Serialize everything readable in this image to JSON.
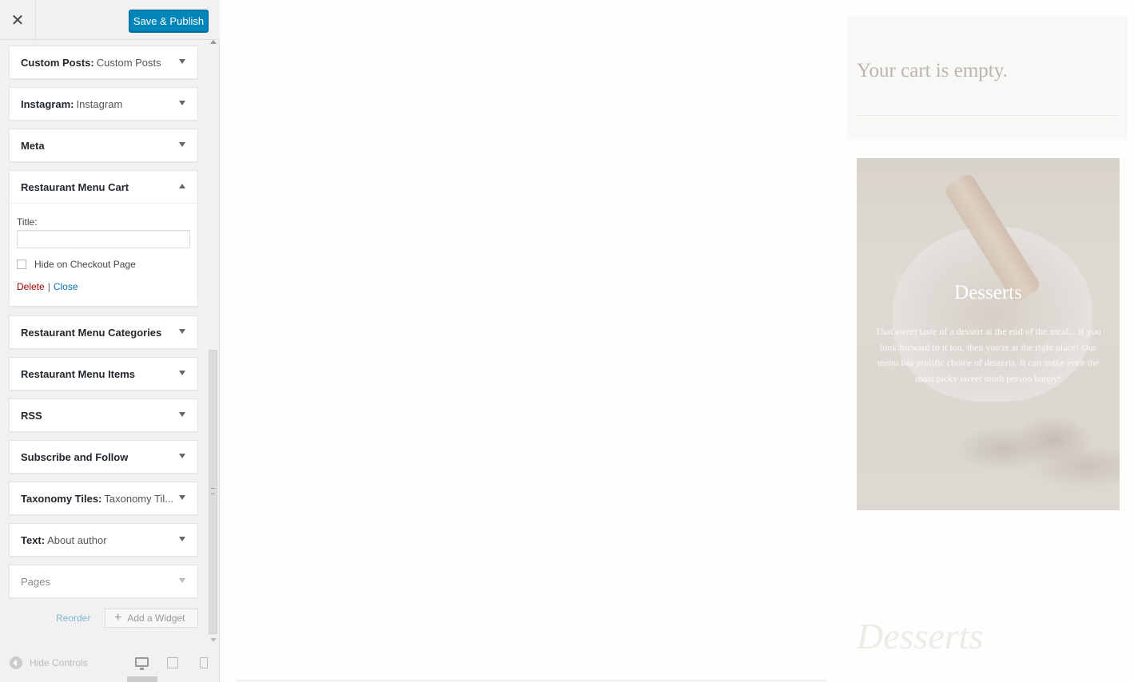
{
  "topbar": {
    "close_label": "✕",
    "publish_label": "Save & Publish"
  },
  "widgets": [
    {
      "title": "Custom Posts:",
      "subtitle": "Custom Posts"
    },
    {
      "title": "Instagram:",
      "subtitle": "Instagram"
    },
    {
      "title": "Meta",
      "subtitle": ""
    },
    {
      "title": "Restaurant Menu Cart",
      "subtitle": "",
      "expanded": true
    },
    {
      "title": "Restaurant Menu Categories",
      "subtitle": ""
    },
    {
      "title": "Restaurant Menu Items",
      "subtitle": ""
    },
    {
      "title": "RSS",
      "subtitle": ""
    },
    {
      "title": "Subscribe and Follow",
      "subtitle": ""
    },
    {
      "title": "Taxonomy Tiles:",
      "subtitle": "Taxonomy Til..."
    },
    {
      "title": "Text:",
      "subtitle": "About author"
    },
    {
      "title": "Pages",
      "subtitle": ""
    }
  ],
  "cart_widget_form": {
    "title_label": "Title:",
    "title_value": "",
    "checkbox_label": "Hide on Checkout Page",
    "checkbox_checked": false,
    "delete_label": "Delete",
    "separator": "|",
    "close_label": "Close"
  },
  "footer": {
    "reorder_label": "Reorder",
    "add_widget_plus": "+",
    "add_widget_label": "Add a Widget"
  },
  "controls": {
    "hide_label": "Hide Controls",
    "active_device": "desktop"
  },
  "preview": {
    "cart_empty_text": "Your cart is empty.",
    "tile_title": "Desserts",
    "tile_description": "That sweet taste of a dessert at the end of the meal... If you look forward to it too, then you're at the right place! Our menu has prolific choice of desserts. It can make even the most picky sweet tooth person happy!",
    "section_title": "Desserts"
  },
  "colors": {
    "primary_button": "#0085ba",
    "delete_link": "#aa0000",
    "close_link": "#0073aa"
  }
}
